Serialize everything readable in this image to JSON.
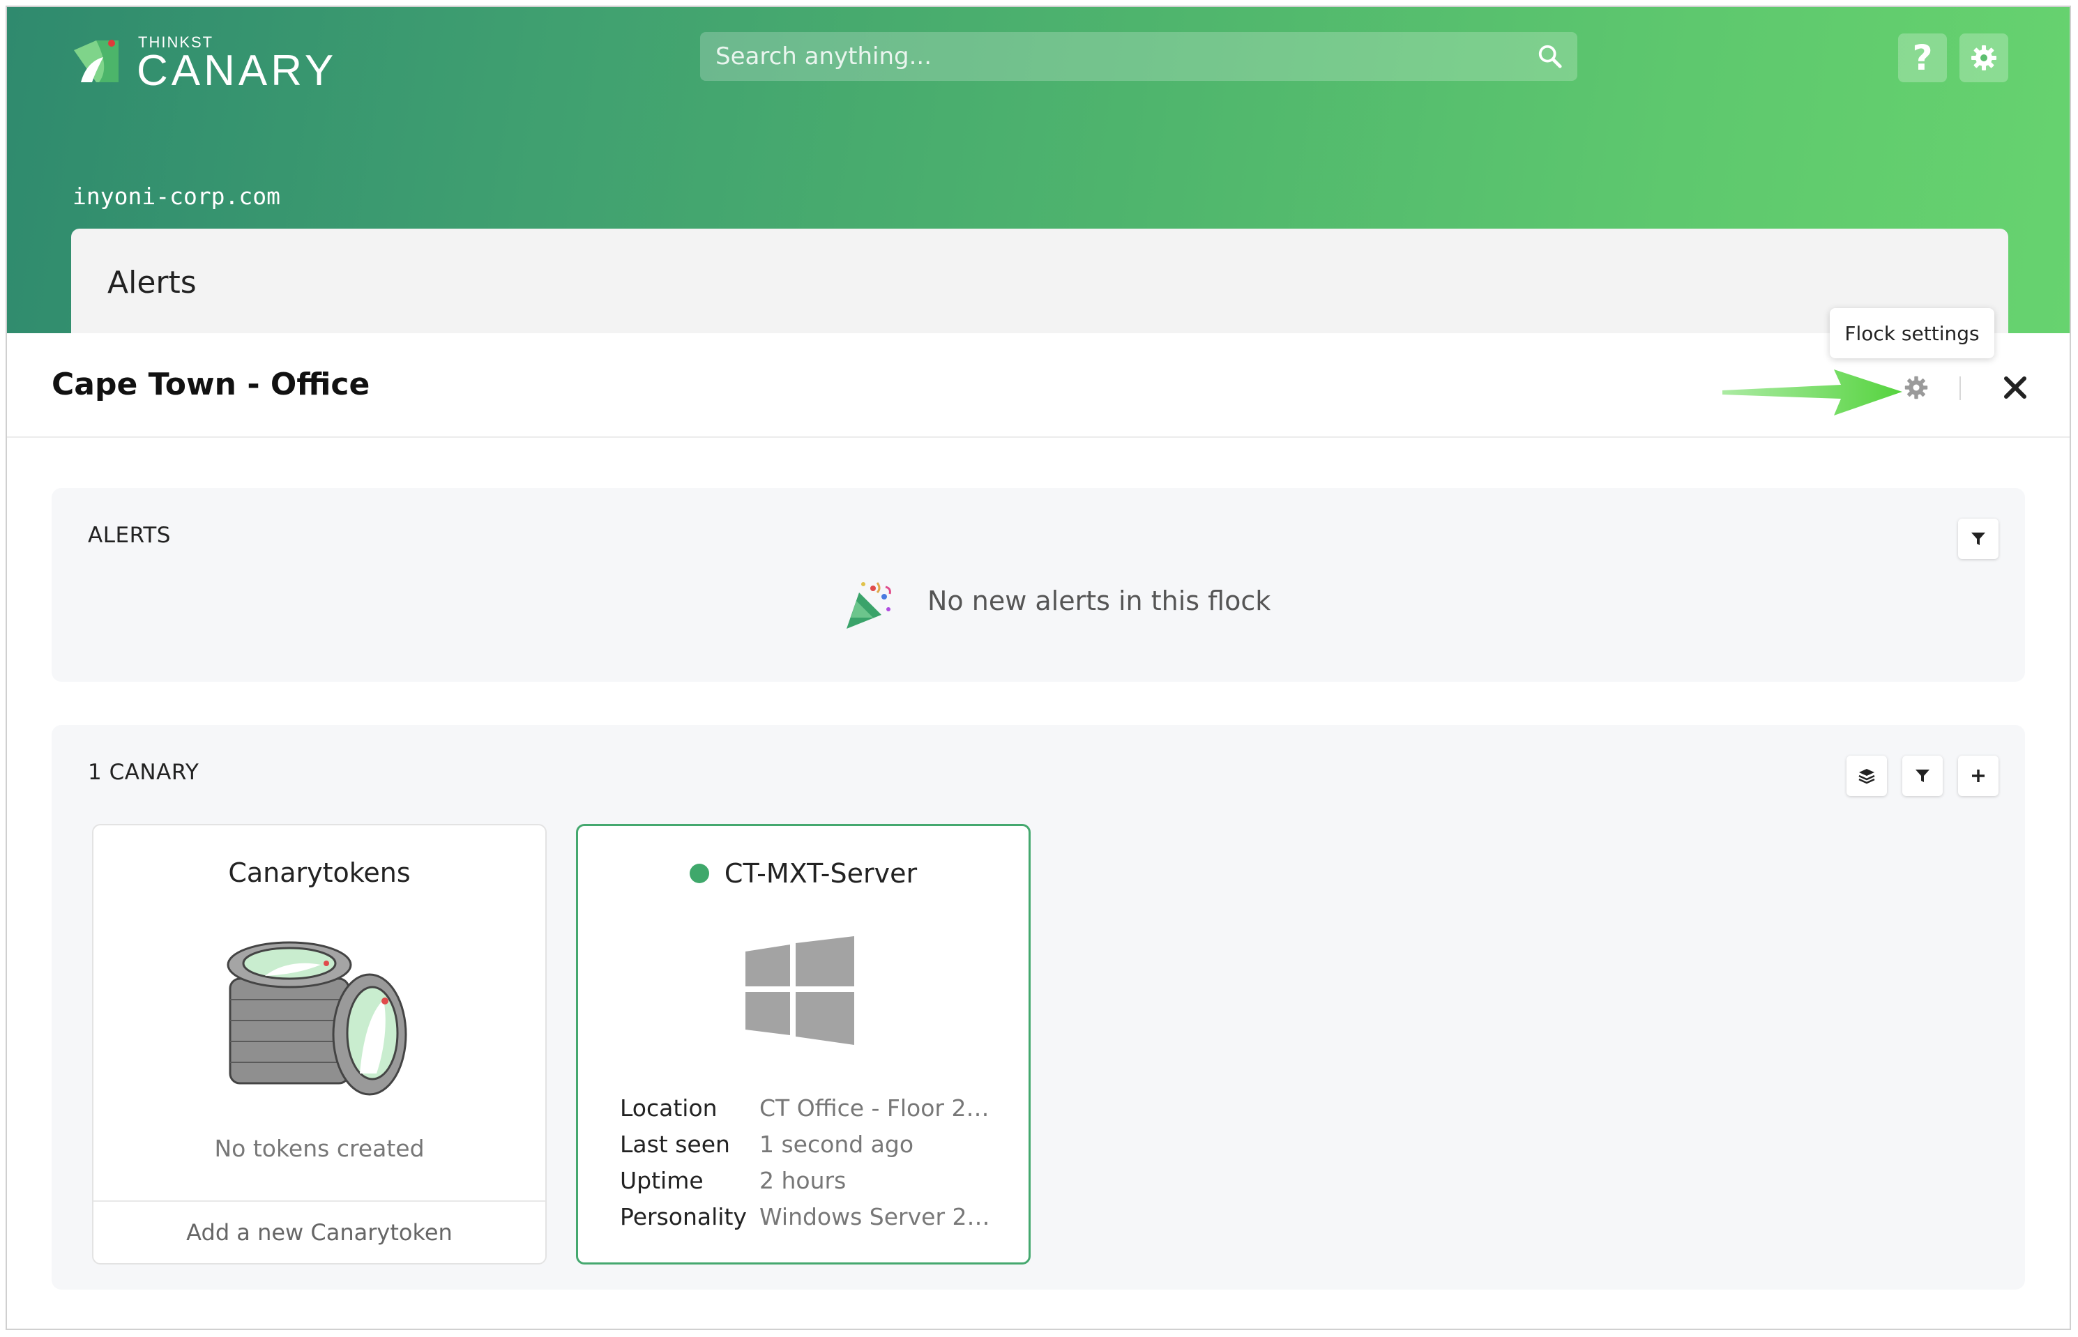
{
  "header": {
    "logo_small": "THINKST",
    "logo_big": "CANARY",
    "search_placeholder": "Search anything...",
    "domain": "inyoni-corp.com",
    "colors": {
      "header_start": "#2f8a6e",
      "header_end": "#67d36f"
    },
    "help_icon": "question-icon",
    "settings_icon": "gear-icon"
  },
  "background_card": {
    "title": "Alerts"
  },
  "panel": {
    "title": "Cape Town - Office",
    "tooltip": "Flock settings",
    "flock_settings_icon": "gear-icon",
    "close_icon": "close-icon"
  },
  "alerts_section": {
    "label": "ALERTS",
    "empty_message": "No new alerts in this flock",
    "filter_icon": "filter-icon"
  },
  "canary_section": {
    "label": "1 CANARY",
    "buttons": [
      "layers-icon",
      "filter-icon",
      "plus-icon"
    ],
    "tokens_card": {
      "title": "Canarytokens",
      "empty": "No tokens created",
      "footer": "Add a new Canarytoken"
    },
    "device_card": {
      "name": "CT-MXT-Server",
      "status_color": "#3fa86b",
      "os_icon": "windows-icon",
      "details": [
        {
          "key": "Location",
          "value": "CT Office - Floor 2…"
        },
        {
          "key": "Last seen",
          "value": "1 second ago"
        },
        {
          "key": "Uptime",
          "value": "2 hours"
        },
        {
          "key": "Personality",
          "value": "Windows Server 2…"
        }
      ]
    }
  }
}
